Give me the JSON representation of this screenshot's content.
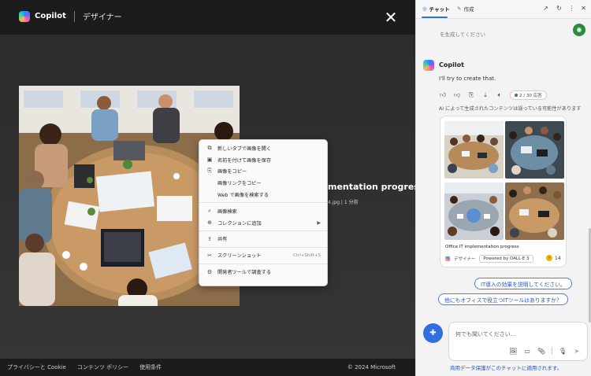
{
  "viewer": {
    "brand": "Copilot",
    "subtitle": "デザイナー",
    "side_title": "mentation progress",
    "side_meta": "4.jpg  |  1 分前",
    "footer": {
      "privacy": "プライバシーと Cookie",
      "policy": "コンテンツ ポリシー",
      "terms": "使用条件",
      "copyright": "© 2024 Microsoft"
    }
  },
  "context_menu": {
    "items": [
      {
        "icon": "new-tab-icon",
        "label": "新しいタブで画像を開く"
      },
      {
        "icon": "save-icon",
        "label": "名前を付けて画像を保存"
      },
      {
        "icon": "copy-image-icon",
        "label": "画像をコピー"
      },
      {
        "icon": "",
        "label": "画像リンクをコピー"
      },
      {
        "icon": "",
        "label": "Web で画像を検索する"
      },
      {
        "icon": "visual-search-icon",
        "label": "画像検索"
      },
      {
        "icon": "collections-icon",
        "label": "コレクションに追加"
      },
      {
        "icon": "share-icon",
        "label": "共有"
      },
      {
        "icon": "screenshot-icon",
        "label": "スクリーンショット",
        "shortcut": "Ctrl+Shift+S"
      },
      {
        "icon": "devtools-icon",
        "label": "開発者ツールで調査する"
      }
    ]
  },
  "panel": {
    "tabs": [
      {
        "label": "チャット",
        "active": true
      },
      {
        "label": "作成",
        "active": false
      }
    ],
    "cut_text": "を生成してください",
    "copilot_name": "Copilot",
    "reply": "I'll try to create that.",
    "counter": "2 / 30 応答",
    "disclaimer": "AI によって生成されたコンテンツは誤っている可能性があります",
    "card": {
      "caption": "Office IT implementation progress",
      "designer": "デザイナー",
      "powered": "Powered by DALL·E 3",
      "coins": "14"
    },
    "suggestions": [
      "IT導入の効果を説明してください。",
      "他にもオフィスで役立つITツールはありますか？"
    ],
    "input_placeholder": "何でも聞いてください...",
    "protection": "商用データ保護がこのチャットに適用されます。"
  },
  "colors": {
    "accent": "#2f6fe0",
    "link": "#2357c4",
    "status_green": "#2b8a3e"
  }
}
